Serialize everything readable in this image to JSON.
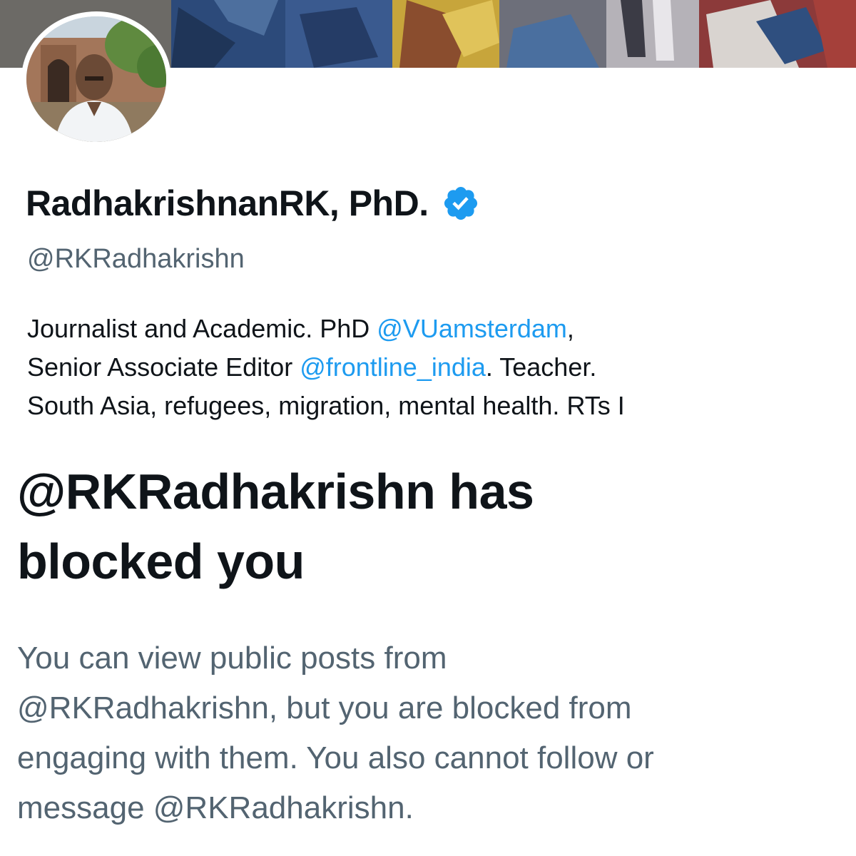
{
  "profile": {
    "display_name": "RadhakrishnanRK, PhD.",
    "handle": "@RKRadhakrishn",
    "verified_icon": "verified-badge-icon",
    "bio": {
      "line1_text": "Journalist and Academic. PhD ",
      "line1_mention": "@VUamsterdam",
      "line1_suffix": ",",
      "line2_text": "Senior Associate Editor ",
      "line2_mention": "@frontline_india",
      "line2_suffix": ". Teacher.",
      "line3_text": "South Asia, refugees, migration, mental health. RTs I"
    }
  },
  "blocked_notice": {
    "title_line1": "@RKRadhakrishn has",
    "title_line2": "blocked you",
    "desc_line1": "You can view public posts from",
    "desc_line2": "@RKRadhakrishn, but you are blocked from",
    "desc_line3": "engaging with them. You also cannot follow or",
    "desc_line4": "message @RKRadhakrishn."
  },
  "colors": {
    "text_primary": "#0f1419",
    "text_secondary": "#536471",
    "link": "#1d9bf0",
    "verified": "#1d9bf0",
    "background": "#ffffff"
  }
}
